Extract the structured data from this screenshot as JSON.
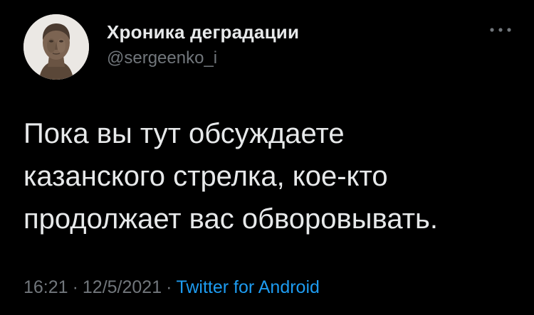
{
  "author": {
    "display_name": "Хроника деградации",
    "handle": "@sergeenko_i",
    "avatar_icon": "roman-bust-avatar"
  },
  "more_icon": "more-horizontal-icon",
  "tweet": {
    "lines": [
      "Пока вы тут обсуждаете",
      "казанского стрелка, кое-кто",
      "продолжает вас обворовывать."
    ]
  },
  "meta": {
    "time": "16:21",
    "separator": "·",
    "date": "12/5/2021",
    "source": "Twitter for Android"
  },
  "colors": {
    "background": "#000000",
    "text": "#e7e9ea",
    "secondary": "#71767b",
    "accent": "#1d9bf0"
  }
}
